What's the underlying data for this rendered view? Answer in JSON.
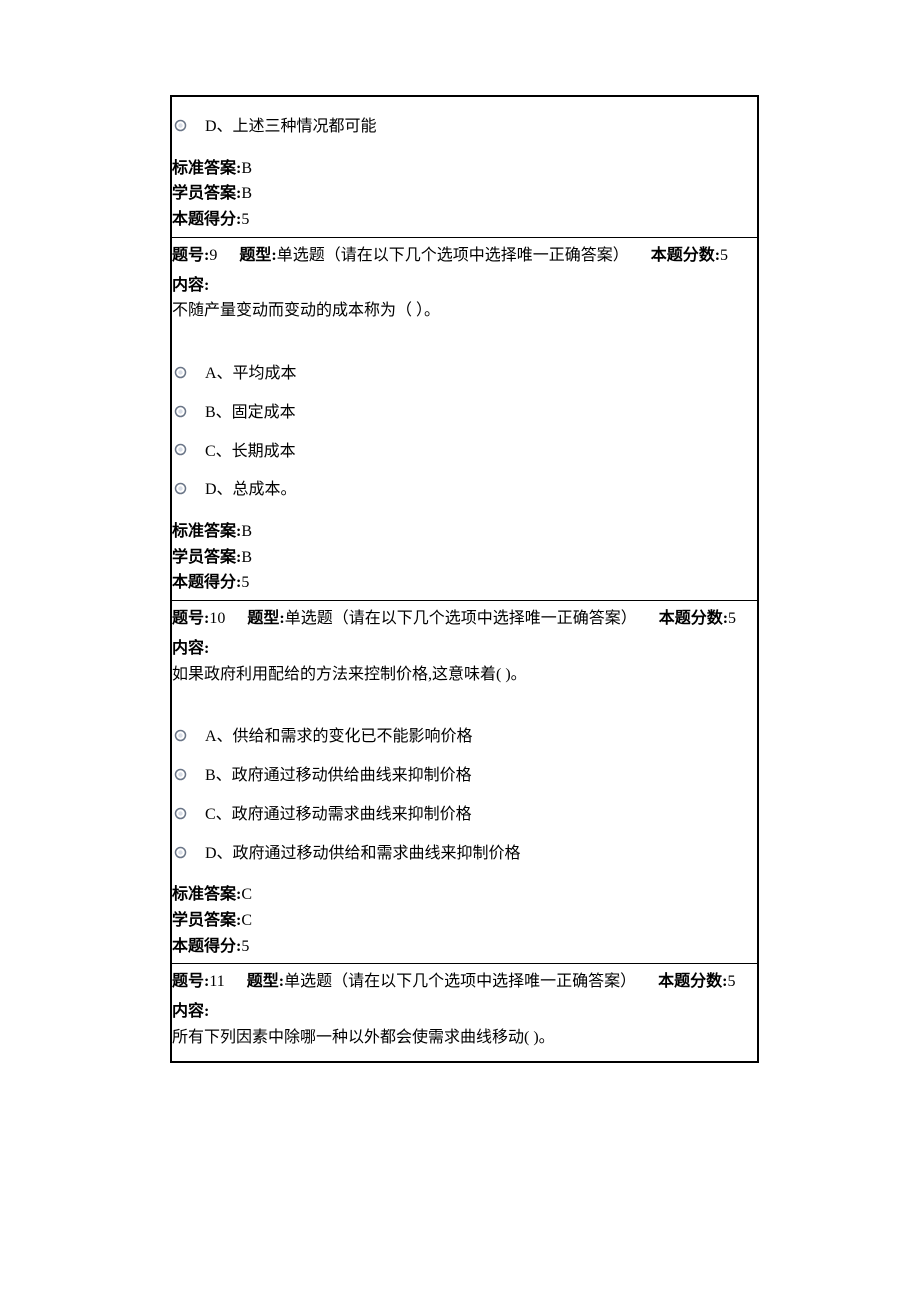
{
  "labels": {
    "question_no": "题号:",
    "type": "题型:",
    "type_value": "单选题（请在以下几个选项中选择唯一正确答案）",
    "full_score": "本题分数:",
    "content": "内容:",
    "std_answer": "标准答案:",
    "stu_answer": "学员答案:",
    "got_score": "本题得分:"
  },
  "q8_tail": {
    "option_d": "D、上述三种情况都可能",
    "std": "B",
    "stu": "B",
    "got": "5"
  },
  "q9": {
    "no": "9",
    "score": "5",
    "body": "不随产量变动而变动的成本称为（ ）。",
    "options": {
      "a": "A、平均成本",
      "b": "B、固定成本",
      "c": "C、长期成本",
      "d": "D、总成本。"
    },
    "std": "B",
    "stu": "B",
    "got": "5"
  },
  "q10": {
    "no": "10",
    "score": "5",
    "body": "如果政府利用配给的方法来控制价格,这意味着( )。",
    "options": {
      "a": "A、供给和需求的变化已不能影响价格",
      "b": "B、政府通过移动供给曲线来抑制价格",
      "c": "C、政府通过移动需求曲线来抑制价格",
      "d": "D、政府通过移动供给和需求曲线来抑制价格"
    },
    "std": "C",
    "stu": "C",
    "got": "5"
  },
  "q11": {
    "no": "11",
    "score": "5",
    "body": "所有下列因素中除哪一种以外都会使需求曲线移动( )。"
  }
}
